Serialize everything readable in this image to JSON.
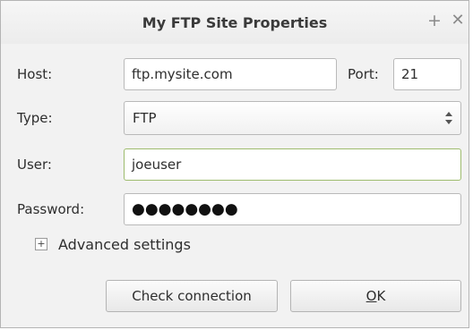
{
  "window": {
    "title": "My FTP Site Properties",
    "pin_icon": "plus-icon",
    "close_icon": "close-icon"
  },
  "form": {
    "host_label": "Host:",
    "host_value": "ftp.mysite.com",
    "port_label": "Port:",
    "port_value": "21",
    "type_label": "Type:",
    "type_value": "FTP",
    "user_label": "User:",
    "user_value": "joeuser",
    "password_label": "Password:",
    "password_mask": "●●●●●●●●"
  },
  "advanced": {
    "label": "Advanced settings",
    "expander_icon": "expand-plus-icon"
  },
  "buttons": {
    "check_label": "Check connection",
    "ok_mnemonic": "O",
    "ok_rest": "K"
  },
  "colors": {
    "focus_border": "#9ebc6e",
    "dialog_bg": "#f2f2f2"
  }
}
